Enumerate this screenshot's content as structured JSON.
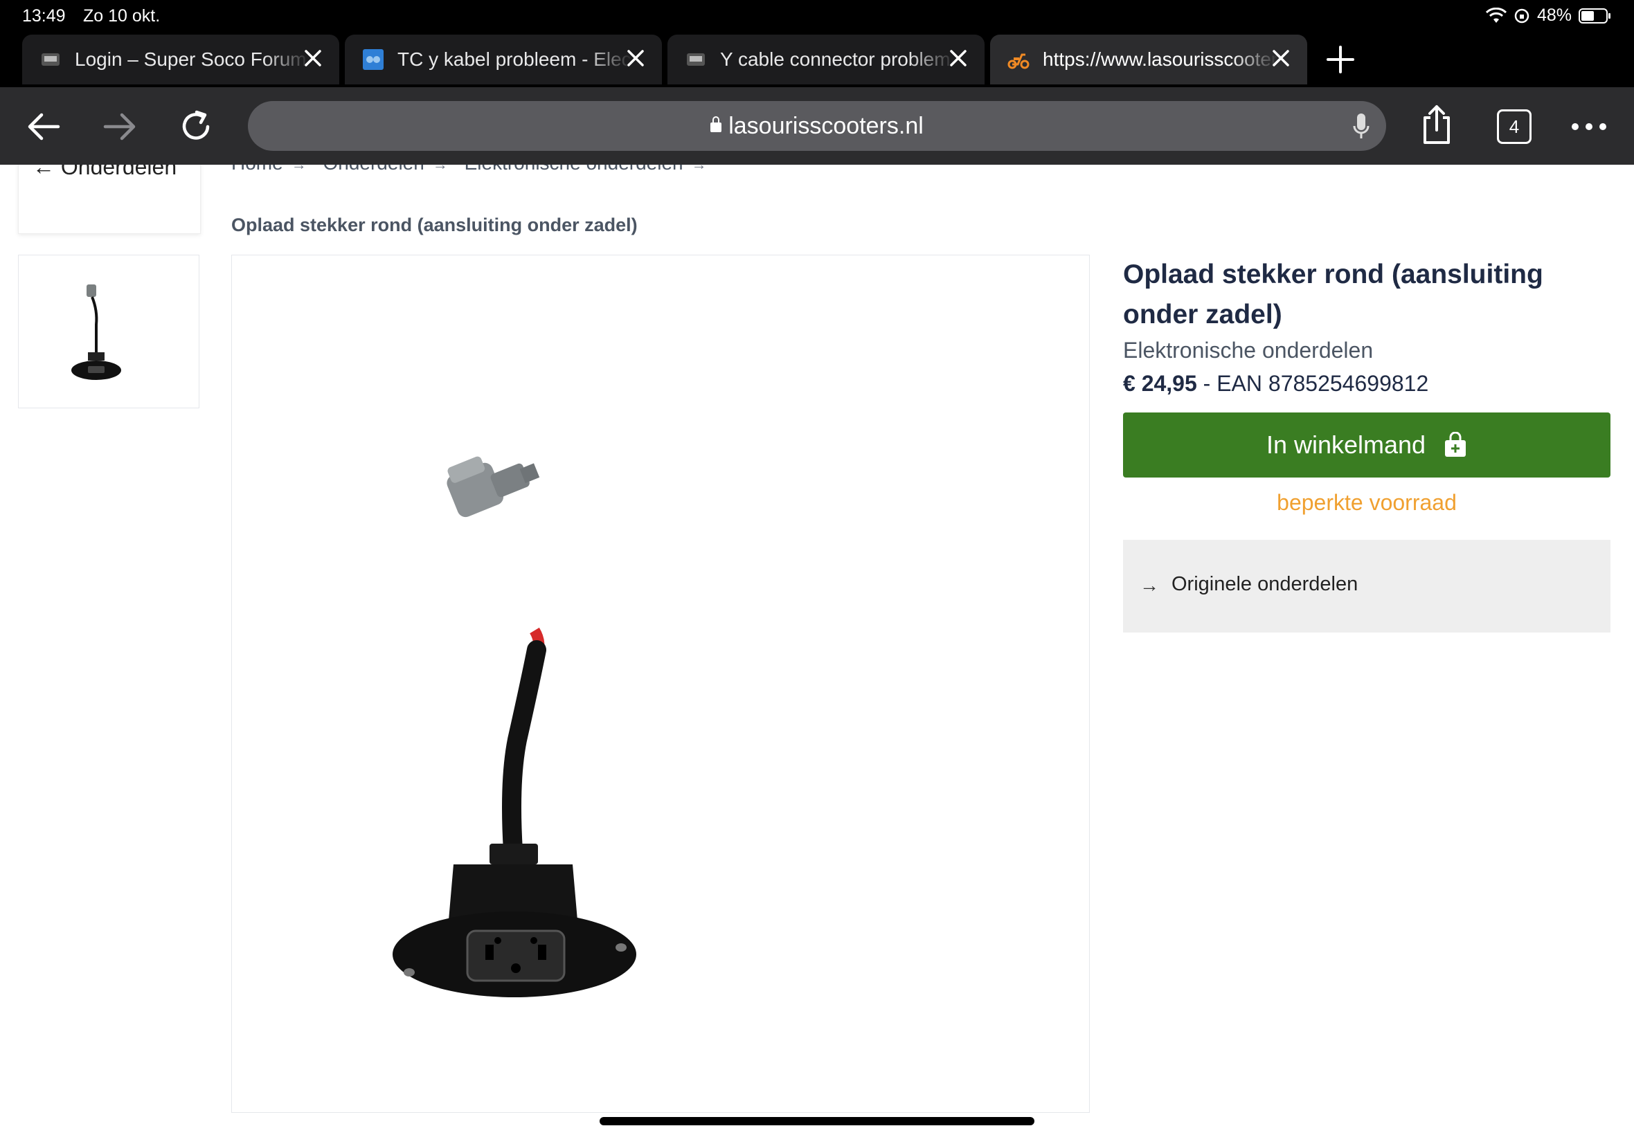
{
  "status": {
    "time": "13:49",
    "date": "Zo 10 okt.",
    "battery": "48%"
  },
  "tabs": [
    {
      "label": "Login – Super Soco Forum",
      "icon": "forum-favicon-icon"
    },
    {
      "label": "TC y kabel probleem - Electric",
      "icon": "blue-favicon-icon"
    },
    {
      "label": "Y cable connector problem",
      "icon": "forum-favicon-icon"
    },
    {
      "label": "https://www.lasourisscooters.nl",
      "icon": "scooter-favicon-icon",
      "active": true
    }
  ],
  "toolbar": {
    "url": "lasourisscooters.nl",
    "tab_count": "4"
  },
  "nav": {
    "back_label": "Onderdelen"
  },
  "breadcrumbs": [
    "Home",
    "Onderdelen",
    "Elektronische onderdelen"
  ],
  "page_title": "Oplaad stekker rond (aansluiting onder zadel)",
  "product": {
    "title": "Oplaad stekker rond (aansluiting onder zadel)",
    "category": "Elektronische onderdelen",
    "price": "€ 24,95",
    "ean": "- EAN 8785254699812",
    "cart_label": "In winkelmand",
    "stock_status": "beperkte voorraad",
    "link_label": "Originele onderdelen"
  },
  "colors": {
    "accent_green": "#3a7d22",
    "stock_orange": "#f0a030",
    "title_navy": "#1f2a44"
  }
}
